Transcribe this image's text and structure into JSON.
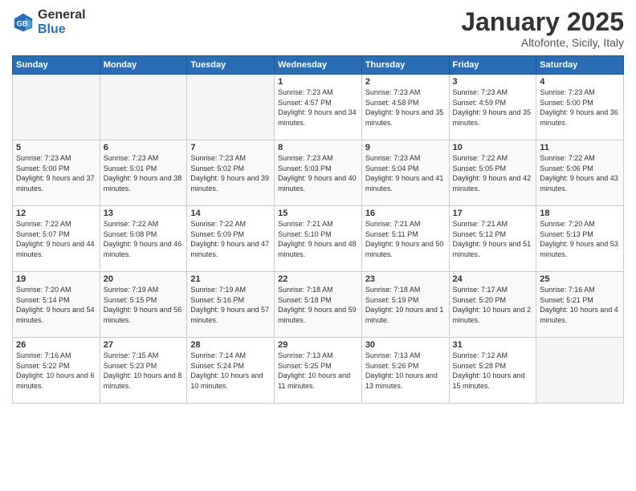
{
  "header": {
    "logo_general": "General",
    "logo_blue": "Blue",
    "month": "January 2025",
    "location": "Altofonte, Sicily, Italy"
  },
  "days_of_week": [
    "Sunday",
    "Monday",
    "Tuesday",
    "Wednesday",
    "Thursday",
    "Friday",
    "Saturday"
  ],
  "weeks": [
    [
      {
        "day": "",
        "info": ""
      },
      {
        "day": "",
        "info": ""
      },
      {
        "day": "",
        "info": ""
      },
      {
        "day": "1",
        "info": "Sunrise: 7:23 AM\nSunset: 4:57 PM\nDaylight: 9 hours\nand 34 minutes."
      },
      {
        "day": "2",
        "info": "Sunrise: 7:23 AM\nSunset: 4:58 PM\nDaylight: 9 hours\nand 35 minutes."
      },
      {
        "day": "3",
        "info": "Sunrise: 7:23 AM\nSunset: 4:59 PM\nDaylight: 9 hours\nand 35 minutes."
      },
      {
        "day": "4",
        "info": "Sunrise: 7:23 AM\nSunset: 5:00 PM\nDaylight: 9 hours\nand 36 minutes."
      }
    ],
    [
      {
        "day": "5",
        "info": "Sunrise: 7:23 AM\nSunset: 5:00 PM\nDaylight: 9 hours\nand 37 minutes."
      },
      {
        "day": "6",
        "info": "Sunrise: 7:23 AM\nSunset: 5:01 PM\nDaylight: 9 hours\nand 38 minutes."
      },
      {
        "day": "7",
        "info": "Sunrise: 7:23 AM\nSunset: 5:02 PM\nDaylight: 9 hours\nand 39 minutes."
      },
      {
        "day": "8",
        "info": "Sunrise: 7:23 AM\nSunset: 5:03 PM\nDaylight: 9 hours\nand 40 minutes."
      },
      {
        "day": "9",
        "info": "Sunrise: 7:23 AM\nSunset: 5:04 PM\nDaylight: 9 hours\nand 41 minutes."
      },
      {
        "day": "10",
        "info": "Sunrise: 7:22 AM\nSunset: 5:05 PM\nDaylight: 9 hours\nand 42 minutes."
      },
      {
        "day": "11",
        "info": "Sunrise: 7:22 AM\nSunset: 5:06 PM\nDaylight: 9 hours\nand 43 minutes."
      }
    ],
    [
      {
        "day": "12",
        "info": "Sunrise: 7:22 AM\nSunset: 5:07 PM\nDaylight: 9 hours\nand 44 minutes."
      },
      {
        "day": "13",
        "info": "Sunrise: 7:22 AM\nSunset: 5:08 PM\nDaylight: 9 hours\nand 46 minutes."
      },
      {
        "day": "14",
        "info": "Sunrise: 7:22 AM\nSunset: 5:09 PM\nDaylight: 9 hours\nand 47 minutes."
      },
      {
        "day": "15",
        "info": "Sunrise: 7:21 AM\nSunset: 5:10 PM\nDaylight: 9 hours\nand 48 minutes."
      },
      {
        "day": "16",
        "info": "Sunrise: 7:21 AM\nSunset: 5:11 PM\nDaylight: 9 hours\nand 50 minutes."
      },
      {
        "day": "17",
        "info": "Sunrise: 7:21 AM\nSunset: 5:12 PM\nDaylight: 9 hours\nand 51 minutes."
      },
      {
        "day": "18",
        "info": "Sunrise: 7:20 AM\nSunset: 5:13 PM\nDaylight: 9 hours\nand 53 minutes."
      }
    ],
    [
      {
        "day": "19",
        "info": "Sunrise: 7:20 AM\nSunset: 5:14 PM\nDaylight: 9 hours\nand 54 minutes."
      },
      {
        "day": "20",
        "info": "Sunrise: 7:19 AM\nSunset: 5:15 PM\nDaylight: 9 hours\nand 56 minutes."
      },
      {
        "day": "21",
        "info": "Sunrise: 7:19 AM\nSunset: 5:16 PM\nDaylight: 9 hours\nand 57 minutes."
      },
      {
        "day": "22",
        "info": "Sunrise: 7:18 AM\nSunset: 5:18 PM\nDaylight: 9 hours\nand 59 minutes."
      },
      {
        "day": "23",
        "info": "Sunrise: 7:18 AM\nSunset: 5:19 PM\nDaylight: 10 hours\nand 1 minute."
      },
      {
        "day": "24",
        "info": "Sunrise: 7:17 AM\nSunset: 5:20 PM\nDaylight: 10 hours\nand 2 minutes."
      },
      {
        "day": "25",
        "info": "Sunrise: 7:16 AM\nSunset: 5:21 PM\nDaylight: 10 hours\nand 4 minutes."
      }
    ],
    [
      {
        "day": "26",
        "info": "Sunrise: 7:16 AM\nSunset: 5:22 PM\nDaylight: 10 hours\nand 6 minutes."
      },
      {
        "day": "27",
        "info": "Sunrise: 7:15 AM\nSunset: 5:23 PM\nDaylight: 10 hours\nand 8 minutes."
      },
      {
        "day": "28",
        "info": "Sunrise: 7:14 AM\nSunset: 5:24 PM\nDaylight: 10 hours\nand 10 minutes."
      },
      {
        "day": "29",
        "info": "Sunrise: 7:13 AM\nSunset: 5:25 PM\nDaylight: 10 hours\nand 11 minutes."
      },
      {
        "day": "30",
        "info": "Sunrise: 7:13 AM\nSunset: 5:26 PM\nDaylight: 10 hours\nand 13 minutes."
      },
      {
        "day": "31",
        "info": "Sunrise: 7:12 AM\nSunset: 5:28 PM\nDaylight: 10 hours\nand 15 minutes."
      },
      {
        "day": "",
        "info": ""
      }
    ]
  ]
}
